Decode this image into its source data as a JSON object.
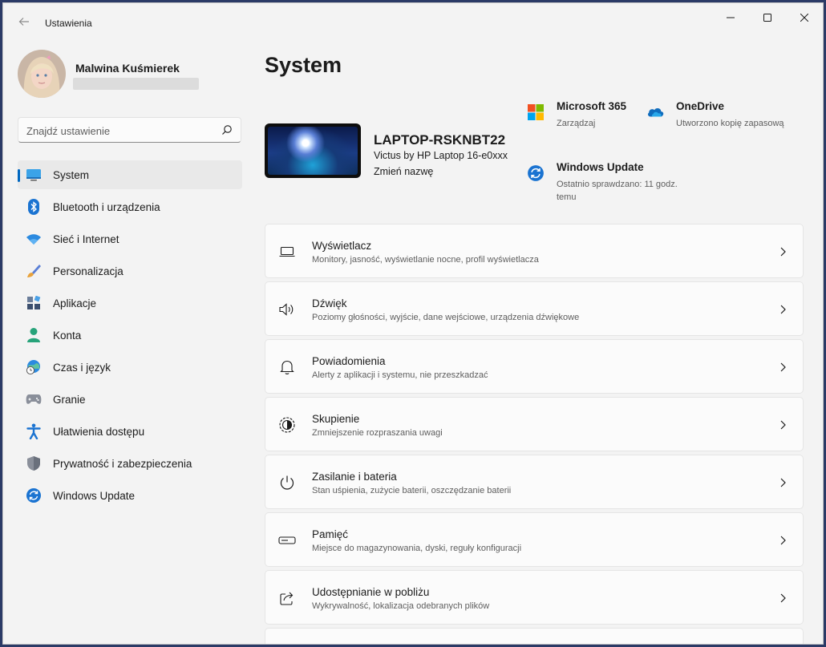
{
  "window": {
    "app_title": "Ustawienia"
  },
  "profile": {
    "name": "Malwina Kuśmierek"
  },
  "search": {
    "placeholder": "Znajdź ustawienie"
  },
  "sidebar": {
    "items": [
      {
        "label": "System",
        "icon": "monitor-icon",
        "active": true
      },
      {
        "label": "Bluetooth i urządzenia",
        "icon": "bluetooth-icon"
      },
      {
        "label": "Sieć i Internet",
        "icon": "wifi-icon"
      },
      {
        "label": "Personalizacja",
        "icon": "brush-icon"
      },
      {
        "label": "Aplikacje",
        "icon": "apps-icon"
      },
      {
        "label": "Konta",
        "icon": "person-icon"
      },
      {
        "label": "Czas i język",
        "icon": "globe-clock-icon"
      },
      {
        "label": "Granie",
        "icon": "gamepad-icon"
      },
      {
        "label": "Ułatwienia dostępu",
        "icon": "accessibility-icon"
      },
      {
        "label": "Prywatność i zabezpieczenia",
        "icon": "shield-icon"
      },
      {
        "label": "Windows Update",
        "icon": "update-icon"
      }
    ]
  },
  "main": {
    "title": "System",
    "device": {
      "name": "LAPTOP-RSKNBT22",
      "model": "Victus by HP Laptop 16-e0xxx",
      "rename": "Zmień nazwę"
    },
    "tiles": {
      "ms365": {
        "title": "Microsoft 365",
        "sub": "Zarządzaj"
      },
      "onedrive": {
        "title": "OneDrive",
        "sub": "Utworzono kopię zapasową"
      },
      "windows_update": {
        "title": "Windows Update",
        "sub_line1": "Ostatnio sprawdzano: 11 godz.",
        "sub_line2": "temu"
      }
    },
    "cards": [
      {
        "title": "Wyświetlacz",
        "sub": "Monitory, jasność, wyświetlanie nocne, profil wyświetlacza",
        "icon": "display-icon"
      },
      {
        "title": "Dźwięk",
        "sub": "Poziomy głośności, wyjście, dane wejściowe, urządzenia dźwiękowe",
        "icon": "speaker-icon"
      },
      {
        "title": "Powiadomienia",
        "sub": "Alerty z aplikacji i systemu, nie przeszkadzać",
        "icon": "bell-icon"
      },
      {
        "title": "Skupienie",
        "sub": "Zmniejszenie rozpraszania uwagi",
        "icon": "focus-icon"
      },
      {
        "title": "Zasilanie i bateria",
        "sub": "Stan uśpienia, zużycie baterii, oszczędzanie baterii",
        "icon": "power-icon"
      },
      {
        "title": "Pamięć",
        "sub": "Miejsce do magazynowania, dyski, reguły konfiguracji",
        "icon": "storage-icon"
      },
      {
        "title": "Udostępnianie w pobliżu",
        "sub": "Wykrywalność, lokalizacja odebranych plików",
        "icon": "share-icon"
      }
    ]
  },
  "colors": {
    "accent": "#0067c0",
    "background": "#f3f3f3",
    "card": "#fbfbfb"
  }
}
